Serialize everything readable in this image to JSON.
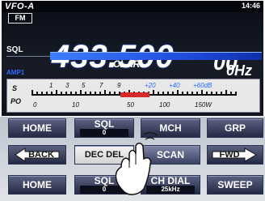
{
  "header": {
    "vfo": "VFO-A",
    "time": "14:46",
    "mode": "FM",
    "sql_label": "SQL"
  },
  "frequency": {
    "main": "433.500",
    "sub": "00"
  },
  "clar": {
    "label": "CLAR",
    "value": "0Hz"
  },
  "amp": "AMP1",
  "meter": {
    "s_label": "S",
    "po_label": "PO",
    "s_scale": [
      "1",
      "3",
      "5",
      "7",
      "9",
      "+20",
      "+40",
      "+60dB"
    ],
    "po_scale": [
      "0",
      "10",
      "50",
      "100",
      "150W"
    ]
  },
  "buttons": {
    "row1": [
      "HOME",
      "SQL",
      "MCH",
      "GRP"
    ],
    "row1_sql_sub": "0",
    "row2": [
      "BACK",
      "DEC DEL",
      "SCAN",
      "FWD"
    ],
    "row3": [
      "HOME",
      "SQL",
      "CH DIAL",
      "SWEEP"
    ],
    "row3_sql_sub": "0",
    "row3_chdial_sub": "25kHz"
  },
  "colors": {
    "accent_blue": "#2b6bff",
    "meter_red": "#d42a2a",
    "button_bg": "#2b3350"
  }
}
